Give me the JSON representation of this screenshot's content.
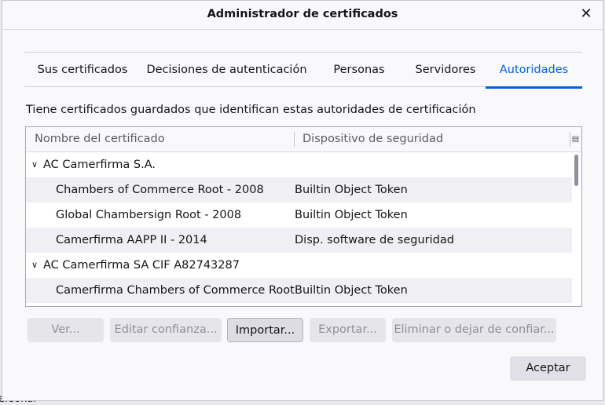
{
  "background": {
    "partial_text": "ersonal"
  },
  "dialog": {
    "title": "Administrador de certificados",
    "close_glyph": "✕"
  },
  "tabs": [
    {
      "label": "Sus certificados",
      "selected": false
    },
    {
      "label": "Decisiones de autenticación",
      "selected": false
    },
    {
      "label": "Personas",
      "selected": false
    },
    {
      "label": "Servidores",
      "selected": false
    },
    {
      "label": "Autoridades",
      "selected": true
    }
  ],
  "description": "Tiene certificados guardados que identifican estas autoridades de certificación",
  "tree": {
    "columns": [
      "Nombre del certificado",
      "Dispositivo de seguridad"
    ],
    "column_picker_icon": "column-picker-icon",
    "rows": [
      {
        "type": "group",
        "name": "AC Camerfirma S.A.",
        "device": ""
      },
      {
        "type": "item",
        "name": "Chambers of Commerce Root - 2008",
        "device": "Builtin Object Token"
      },
      {
        "type": "item",
        "name": "Global Chambersign Root - 2008",
        "device": "Builtin Object Token"
      },
      {
        "type": "item",
        "name": "Camerfirma AAPP II - 2014",
        "device": "Disp. software de seguridad"
      },
      {
        "type": "group",
        "name": "AC Camerfirma SA CIF A82743287",
        "device": ""
      },
      {
        "type": "item",
        "name": "Camerfirma Chambers of Commerce Root",
        "device": "Builtin Object Token"
      }
    ]
  },
  "buttons": {
    "view": "Ver...",
    "edit_trust": "Editar confianza...",
    "import": "Importar...",
    "export": "Exportar...",
    "delete": "Eliminar o dejar de confiar...",
    "accept": "Aceptar"
  },
  "colors": {
    "accent": "#0061e0",
    "dialog_bg": "#f9f9fb",
    "disabled_text": "#8f8f9d"
  }
}
